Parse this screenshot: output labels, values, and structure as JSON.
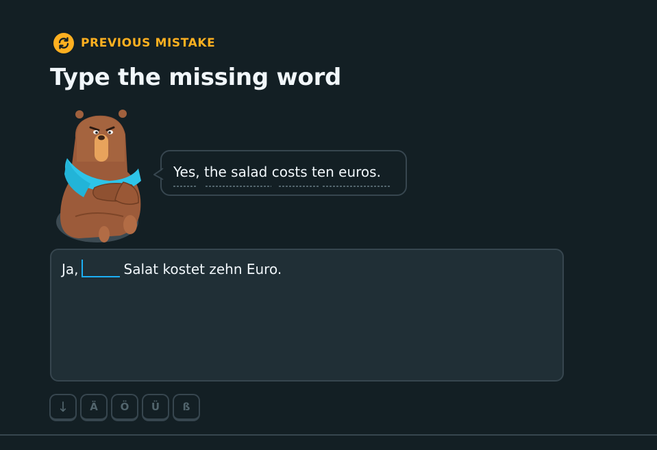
{
  "header": {
    "badge_icon": "refresh-icon",
    "badge_label": "PREVIOUS MISTAKE",
    "title": "Type the missing word"
  },
  "character": {
    "icon": "bear-character"
  },
  "speech_bubble": {
    "text": "Yes, the salad costs ten euros."
  },
  "exercise": {
    "prefix": "Ja,",
    "blank_value": "",
    "suffix": "Salat kostet zehn Euro."
  },
  "special_keys": [
    {
      "label": "↓",
      "name": "collapse-keys-button"
    },
    {
      "label": "Ä",
      "name": "key-a-umlaut"
    },
    {
      "label": "Ö",
      "name": "key-o-umlaut"
    },
    {
      "label": "Ü",
      "name": "key-u-umlaut"
    },
    {
      "label": "ß",
      "name": "key-eszett"
    }
  ],
  "colors": {
    "background": "#131f24",
    "accent_orange": "#ffb020",
    "input_blue": "#1cb0f6",
    "border": "#37464f",
    "panel": "#202f36"
  }
}
